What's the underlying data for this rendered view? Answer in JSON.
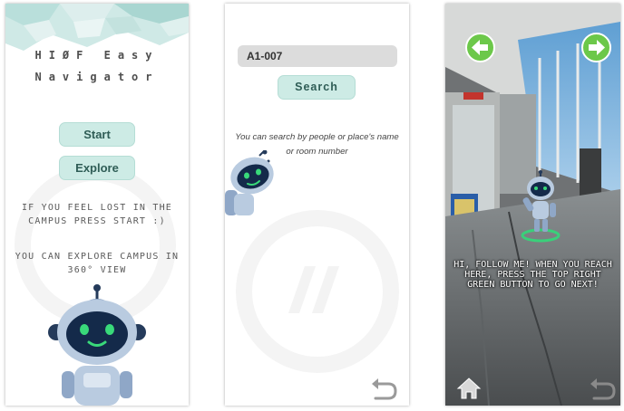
{
  "screen_home": {
    "title_line1": "HIØF Easy",
    "title_line2": "Navigator",
    "start_label": "Start",
    "explore_label": "Explore",
    "lost_text": "IF YOU FEEL LOST IN THE CAMPUS PRESS START :)",
    "explore_text": "YOU CAN EXPLORE CAMPUS IN 360° VIEW",
    "robot_icon": "robot-mascot"
  },
  "screen_search": {
    "search_value": "A1-007",
    "search_label": "Search",
    "hint_text": "You can search by people or place's name or room number",
    "back_icon": "undo-arrow-icon"
  },
  "screen_ar": {
    "message": "HI, FOLLOW ME! WHEN YOU REACH HERE, PRESS THE TOP RIGHT GREEN BUTTON TO GO NEXT!",
    "prev_icon": "arrow-left-icon",
    "next_icon": "arrow-right-icon",
    "home_icon": "home-icon",
    "back_icon": "undo-arrow-icon",
    "accent_color": "#6cc84a"
  },
  "colors": {
    "mint_button": "#cdebe5",
    "text_gray": "#5a5a5a"
  }
}
